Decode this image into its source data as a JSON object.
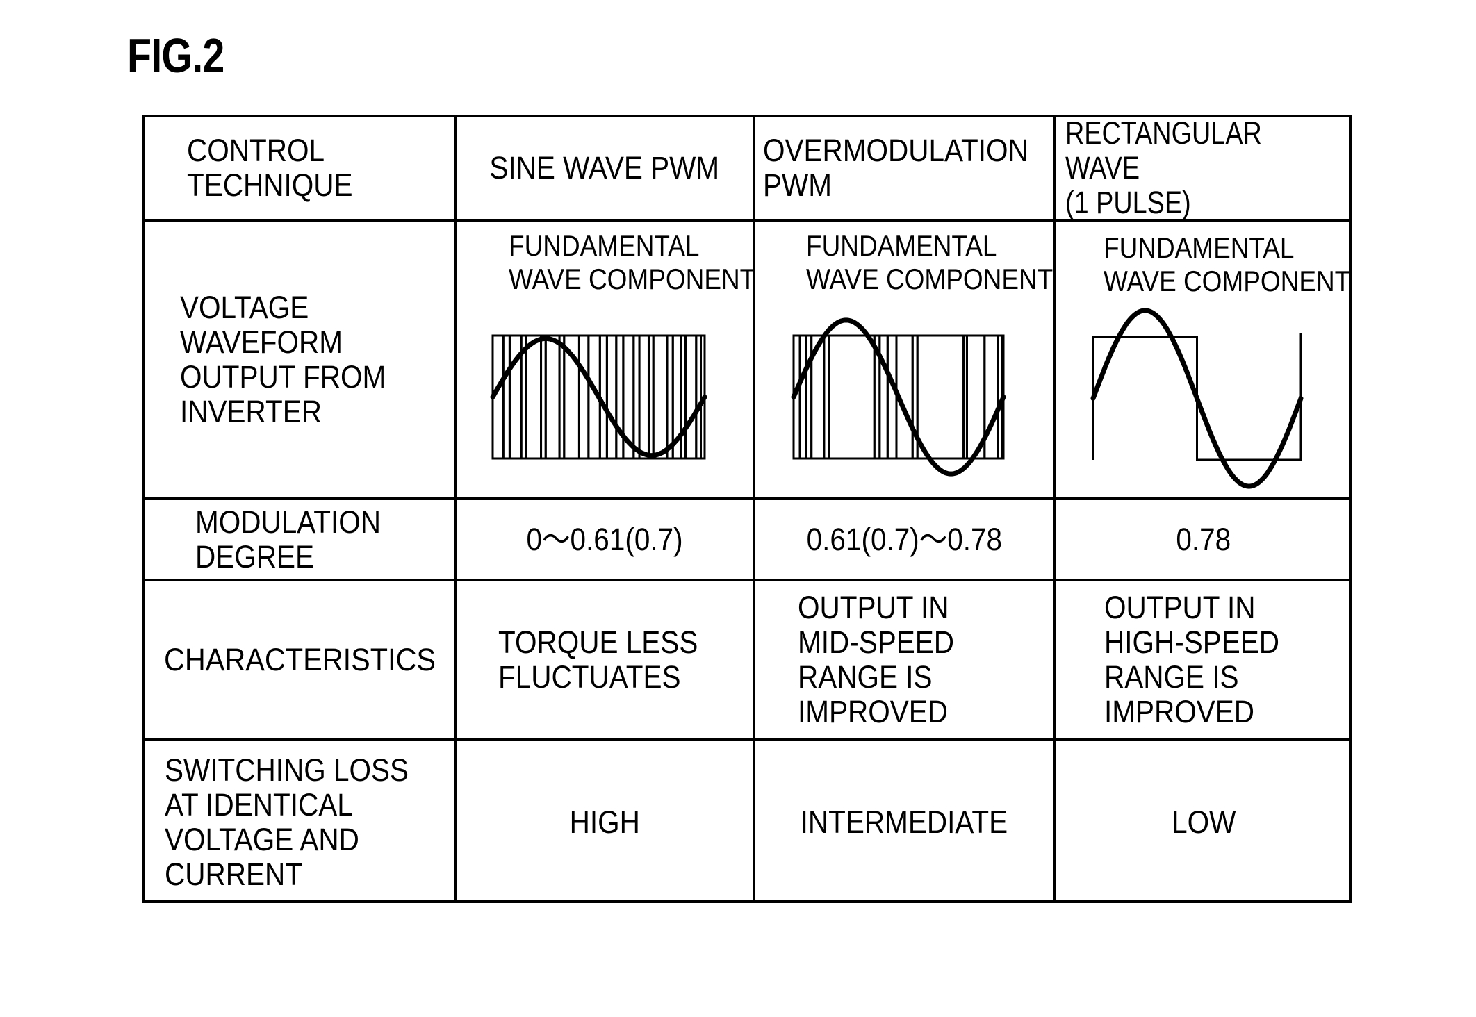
{
  "figure": {
    "title": "FIG.2"
  },
  "table": {
    "row_headers": {
      "control_technique": "CONTROL\nTECHNIQUE",
      "voltage_waveform": "VOLTAGE\nWAVEFORM\nOUTPUT FROM\nINVERTER",
      "modulation_degree": "MODULATION\nDEGREE",
      "characteristics": "CHARACTERISTICS",
      "switching_loss": "SWITCHING LOSS\nAT IDENTICAL\nVOLTAGE AND\nCURRENT"
    },
    "columns": [
      {
        "technique": "SINE WAVE PWM",
        "waveform_label": "FUNDAMENTAL\nWAVE COMPONENT",
        "modulation_degree": "0～0.61(0.7)",
        "characteristics": "TORQUE LESS\nFLUCTUATES",
        "switching_loss": "HIGH"
      },
      {
        "technique": "OVERMODULATION\nPWM",
        "waveform_label": "FUNDAMENTAL\nWAVE COMPONENT",
        "modulation_degree": "0.61(0.7)～0.78",
        "characteristics": "OUTPUT IN\nMID-SPEED\nRANGE IS\nIMPROVED",
        "switching_loss": "INTERMEDIATE"
      },
      {
        "technique": "RECTANGULAR WAVE\n(1 PULSE)",
        "waveform_label": "FUNDAMENTAL\nWAVE COMPONENT",
        "modulation_degree": "0.78",
        "characteristics": "OUTPUT IN\nHIGH-SPEED\nRANGE IS\nIMPROVED",
        "switching_loss": "LOW"
      }
    ]
  },
  "waveforms": [
    {
      "name": "sine-wave-pwm",
      "fundamental_amplitude": 0.95,
      "pulse_transitions": [
        0.0,
        0.05,
        0.08,
        0.135,
        0.157,
        0.228,
        0.25,
        0.315,
        0.337,
        0.408,
        0.452,
        0.506,
        0.539,
        0.583,
        0.616,
        0.665,
        0.692,
        0.736,
        0.758,
        0.823,
        0.85,
        0.888,
        0.91,
        0.96,
        0.982,
        1.0
      ],
      "start_level": "high"
    },
    {
      "name": "overmodulation-pwm",
      "fundamental_amplitude": 1.25,
      "pulse_transitions": [
        0.0,
        0.03,
        0.058,
        0.085,
        0.145,
        0.17,
        0.385,
        0.41,
        0.448,
        0.49,
        0.567,
        0.59,
        0.81,
        0.826,
        0.91,
        0.975,
        0.995,
        1.0
      ],
      "start_level": "high"
    },
    {
      "name": "rectangular-wave-1-pulse",
      "fundamental_amplitude": 1.43,
      "pulse_transitions": [
        0.0,
        0.5,
        1.0
      ],
      "start_level": "high"
    }
  ]
}
